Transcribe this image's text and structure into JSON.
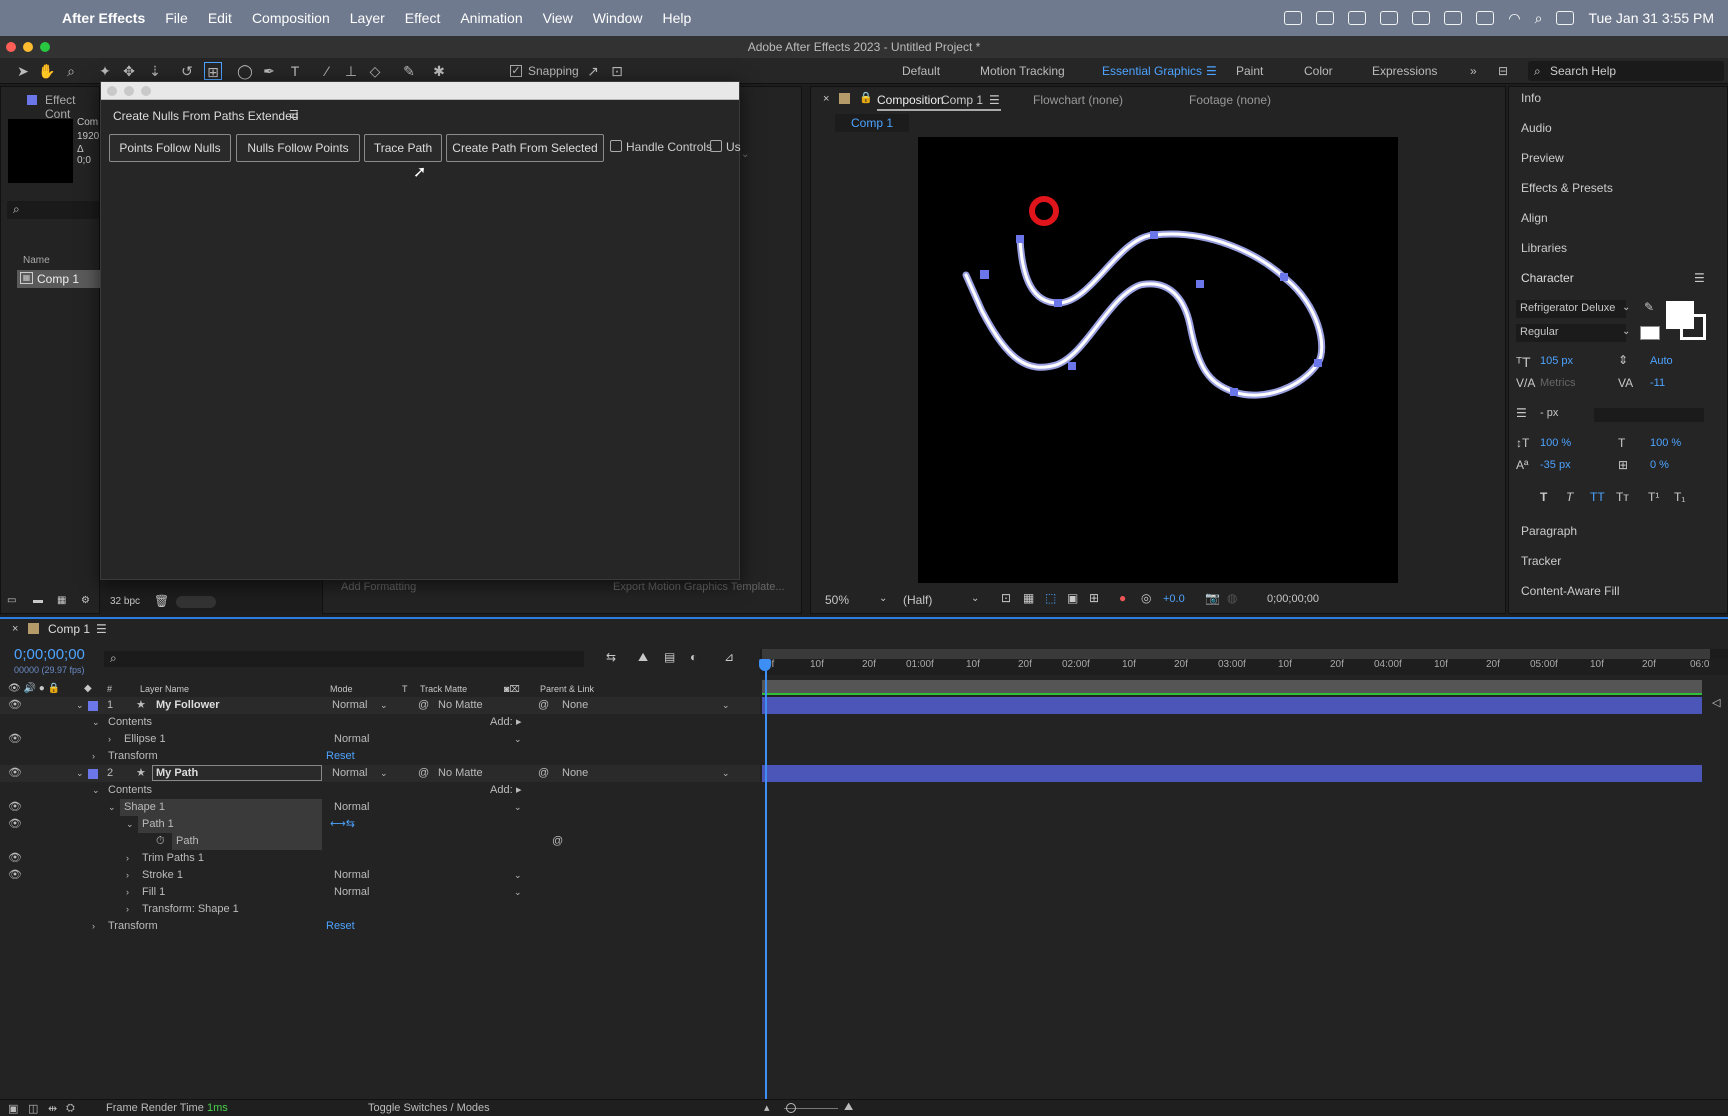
{
  "menubar": {
    "app_name": "After Effects",
    "items": [
      "File",
      "Edit",
      "Composition",
      "Layer",
      "Effect",
      "Animation",
      "View",
      "Window",
      "Help"
    ],
    "clock": "Tue Jan 31  3:55 PM"
  },
  "window_title": "Adobe After Effects 2023 - Untitled Project *",
  "toolbar": {
    "snapping_label": "Snapping",
    "workspaces": [
      "Default",
      "Motion Tracking",
      "Essential Graphics",
      "Paint",
      "Color",
      "Expressions"
    ],
    "active_workspace": "Essential Graphics",
    "search_placeholder": "Search Help"
  },
  "project_panel": {
    "tab_label": "Effect Cont",
    "comp_info_1": "Com",
    "comp_info_2": "1920",
    "comp_info_3": "Δ 0;0",
    "name_header": "Name",
    "item_label": "Comp 1",
    "bpc": "32 bpc"
  },
  "essential_panel": {
    "add_formatting": "Add Formatting",
    "export_template": "Export Motion Graphics Template..."
  },
  "float_window": {
    "title": "Create Nulls From Paths Extended",
    "buttons": [
      "Points Follow Nulls",
      "Nulls Follow Points",
      "Trace Path",
      "Create Path From Selected"
    ],
    "checkbox_handle": "Handle Controls",
    "checkbox_u": "Us"
  },
  "viewer": {
    "tab_comp_prefix": "Composition",
    "tab_comp_name": "Comp 1",
    "tab_flowchart": "Flowchart (none)",
    "tab_footage": "Footage (none)",
    "subtab": "Comp 1",
    "zoom": "50%",
    "resolution": "(Half)",
    "exposure": "+0.0",
    "timecode": "0;00;00;00"
  },
  "right_panel": {
    "items_top": [
      "Info",
      "Audio",
      "Preview",
      "Effects & Presets",
      "Align",
      "Libraries"
    ],
    "character_title": "Character",
    "font_name": "Refrigerator Deluxe",
    "font_style": "Regular",
    "font_size": "105 px",
    "leading": "Auto",
    "kerning": "Metrics",
    "tracking": "-11",
    "stroke_width": "- px",
    "vert_scale": "100 %",
    "horiz_scale": "100 %",
    "baseline": "-35 px",
    "tsume": "0 %",
    "style_buttons": [
      "T",
      "T",
      "TT",
      "Tт",
      "T¹",
      "T₁"
    ],
    "items_bottom": [
      "Paragraph",
      "Tracker",
      "Content-Aware Fill"
    ]
  },
  "timeline": {
    "tab_label": "Comp 1",
    "timecode": "0;00;00;00",
    "fps": "00000 (29.97 fps)",
    "headers": {
      "num": "#",
      "layer_name": "Layer Name",
      "mode": "Mode",
      "t": "T",
      "track_matte": "Track Matte",
      "parent": "Parent & Link"
    },
    "ruler": [
      "0f",
      "10f",
      "20f",
      "01:00f",
      "10f",
      "20f",
      "02:00f",
      "10f",
      "20f",
      "03:00f",
      "10f",
      "20f",
      "04:00f",
      "10f",
      "20f",
      "05:00f",
      "10f",
      "20f",
      "06:0"
    ],
    "rows": [
      {
        "num": "1",
        "name": "My Follower",
        "mode": "Normal",
        "matte": "No Matte",
        "parent": "None"
      },
      {
        "name": "Contents",
        "add": "Add:"
      },
      {
        "name": "Ellipse 1",
        "mode": "Normal"
      },
      {
        "name": "Transform",
        "reset": "Reset"
      },
      {
        "num": "2",
        "name": "My Path",
        "mode": "Normal",
        "matte": "No Matte",
        "parent": "None"
      },
      {
        "name": "Contents",
        "add": "Add:"
      },
      {
        "name": "Shape 1",
        "mode": "Normal"
      },
      {
        "name": "Path 1"
      },
      {
        "name": "Path"
      },
      {
        "name": "Trim Paths 1"
      },
      {
        "name": "Stroke 1",
        "mode": "Normal"
      },
      {
        "name": "Fill 1",
        "mode": "Normal"
      },
      {
        "name": "Transform: Shape 1"
      },
      {
        "name": "Transform",
        "reset": "Reset"
      }
    ]
  },
  "status": {
    "render_label": "Frame Render Time",
    "render_value": "1ms",
    "toggle": "Toggle Switches / Modes"
  },
  "colors": {
    "accent": "#4da3ff",
    "layer_bar": "#4c55b8",
    "path_stroke": "#ffffff",
    "vertex": "#6b76e8",
    "follower": "#e0141b"
  }
}
